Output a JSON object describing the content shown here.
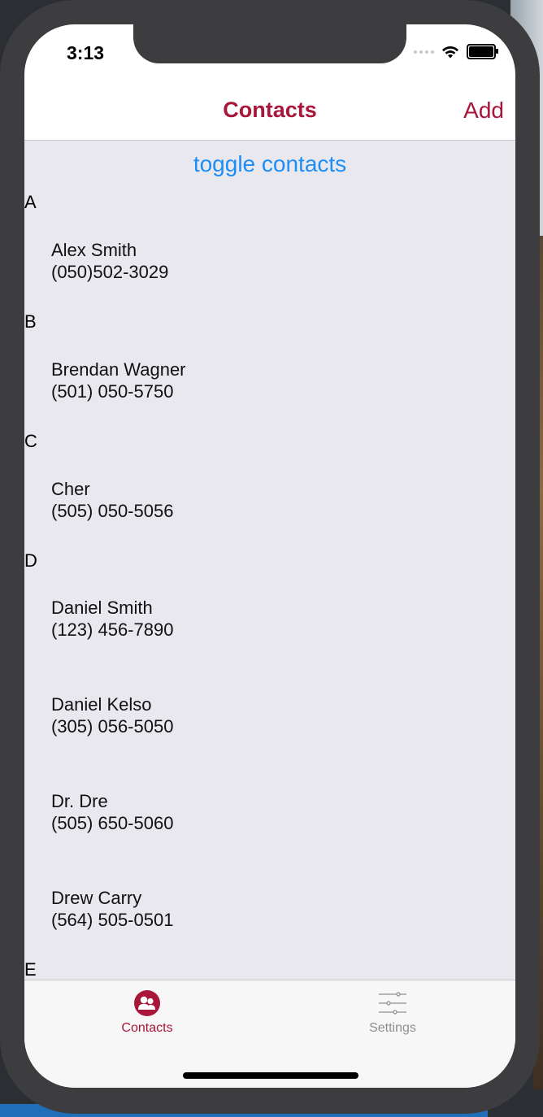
{
  "status": {
    "time": "3:13"
  },
  "nav": {
    "title": "Contacts",
    "add_label": "Add"
  },
  "toggle_label": "toggle contacts",
  "sections": [
    {
      "letter": "A",
      "contacts": [
        {
          "name": "Alex Smith",
          "phone": "(050)502-3029"
        }
      ]
    },
    {
      "letter": "B",
      "contacts": [
        {
          "name": "Brendan Wagner",
          "phone": "(501) 050-5750"
        }
      ]
    },
    {
      "letter": "C",
      "contacts": [
        {
          "name": "Cher",
          "phone": "(505) 050-5056"
        }
      ]
    },
    {
      "letter": "D",
      "contacts": [
        {
          "name": "Daniel Smith",
          "phone": "(123) 456-7890"
        },
        {
          "name": "Daniel Kelso",
          "phone": "(305) 056-5050"
        },
        {
          "name": "Dr. Dre",
          "phone": "(505) 650-5060"
        },
        {
          "name": "Drew Carry",
          "phone": "(564) 505-0501"
        }
      ]
    },
    {
      "letter": "E",
      "contacts": []
    }
  ],
  "tabs": [
    {
      "label": "Contacts",
      "icon": "contacts-icon",
      "selected": true
    },
    {
      "label": "Settings",
      "icon": "sliders-icon",
      "selected": false
    }
  ],
  "colors": {
    "accent": "#a8163a",
    "link": "#1d8ef4",
    "list_bg": "#e9e8ef"
  }
}
